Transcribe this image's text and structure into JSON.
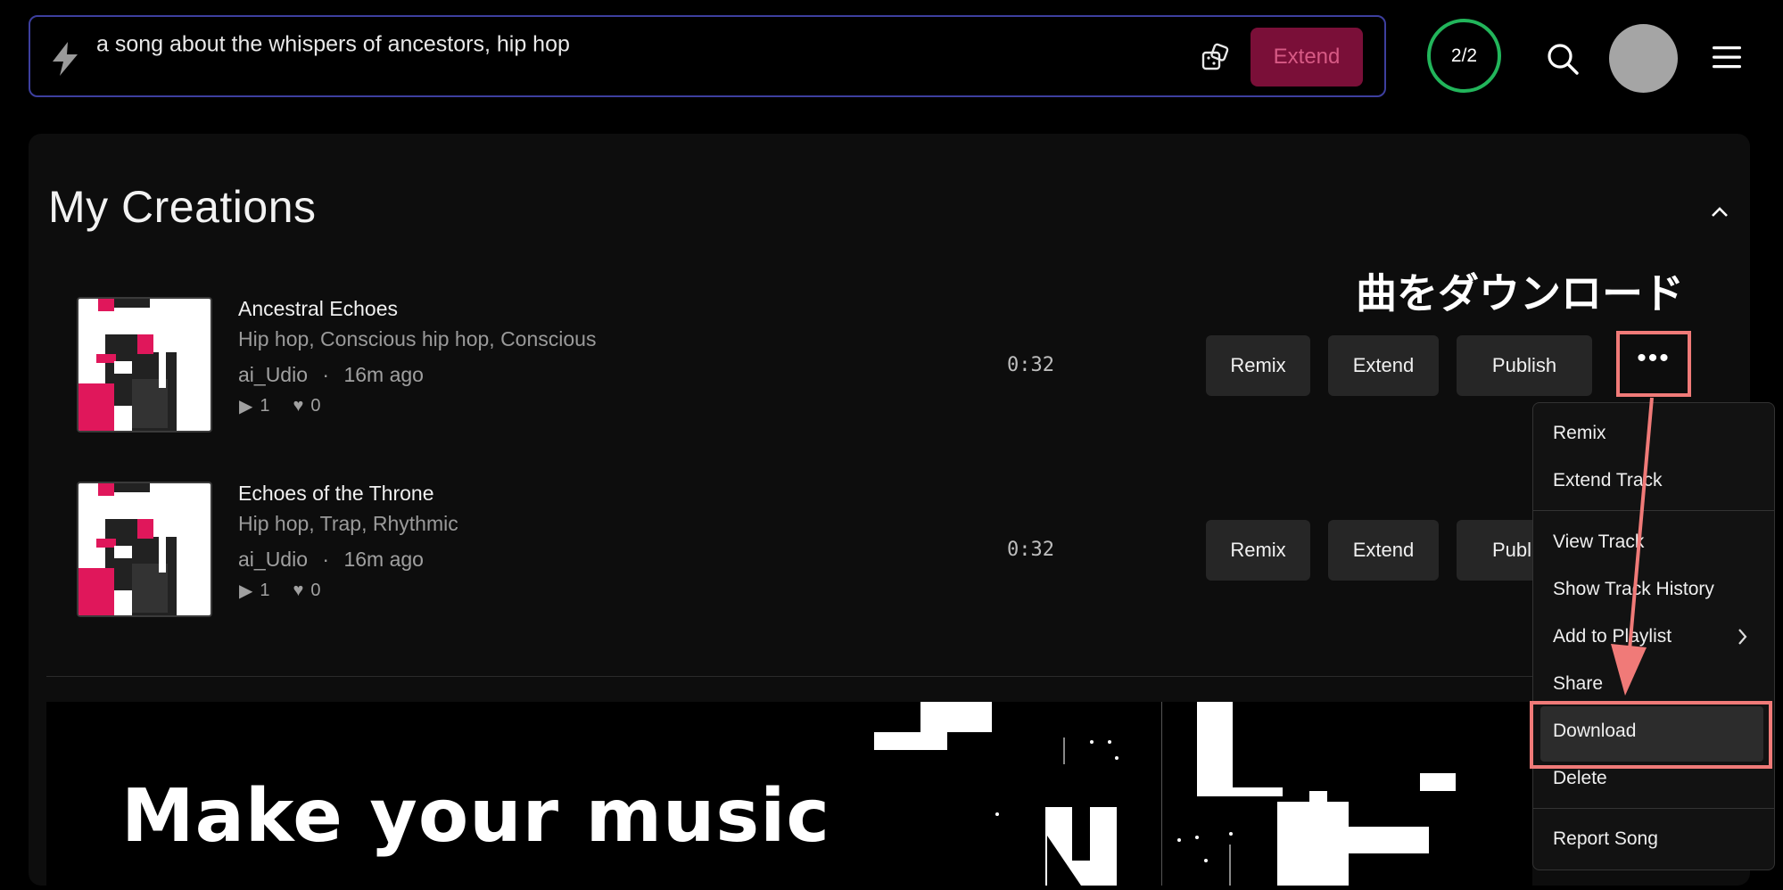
{
  "prompt": {
    "text": "a song about the whispers of ancestors, hip hop",
    "extend_label": "Extend"
  },
  "header": {
    "counter": "2/2"
  },
  "section": {
    "title": "My Creations"
  },
  "annotation": {
    "text": "曲をダウンロード"
  },
  "tracks": [
    {
      "title": "Ancestral Echoes",
      "tags": "Hip hop, Conscious hip hop, Conscious",
      "author": "ai_Udio",
      "age": "16m ago",
      "plays": "1",
      "likes": "0",
      "duration": "0:32",
      "remix_label": "Remix",
      "extend_label": "Extend",
      "publish_label": "Publish"
    },
    {
      "title": "Echoes of the Throne",
      "tags": "Hip hop, Trap, Rhythmic",
      "author": "ai_Udio",
      "age": "16m ago",
      "plays": "1",
      "likes": "0",
      "duration": "0:32",
      "remix_label": "Remix",
      "extend_label": "Extend",
      "publish_label": "Publi"
    }
  ],
  "menu": {
    "items": [
      "Remix",
      "Extend Track",
      "View Track",
      "Show Track History",
      "Add to Playlist",
      "Share",
      "Download",
      "Delete",
      "Report Song"
    ]
  },
  "banner": {
    "title": "Make your music"
  },
  "colors": {
    "accent_pink": "#e0175b",
    "highlight_red": "#f07a78",
    "counter_green": "#22b55b",
    "prompt_border": "#3d3f9e"
  }
}
